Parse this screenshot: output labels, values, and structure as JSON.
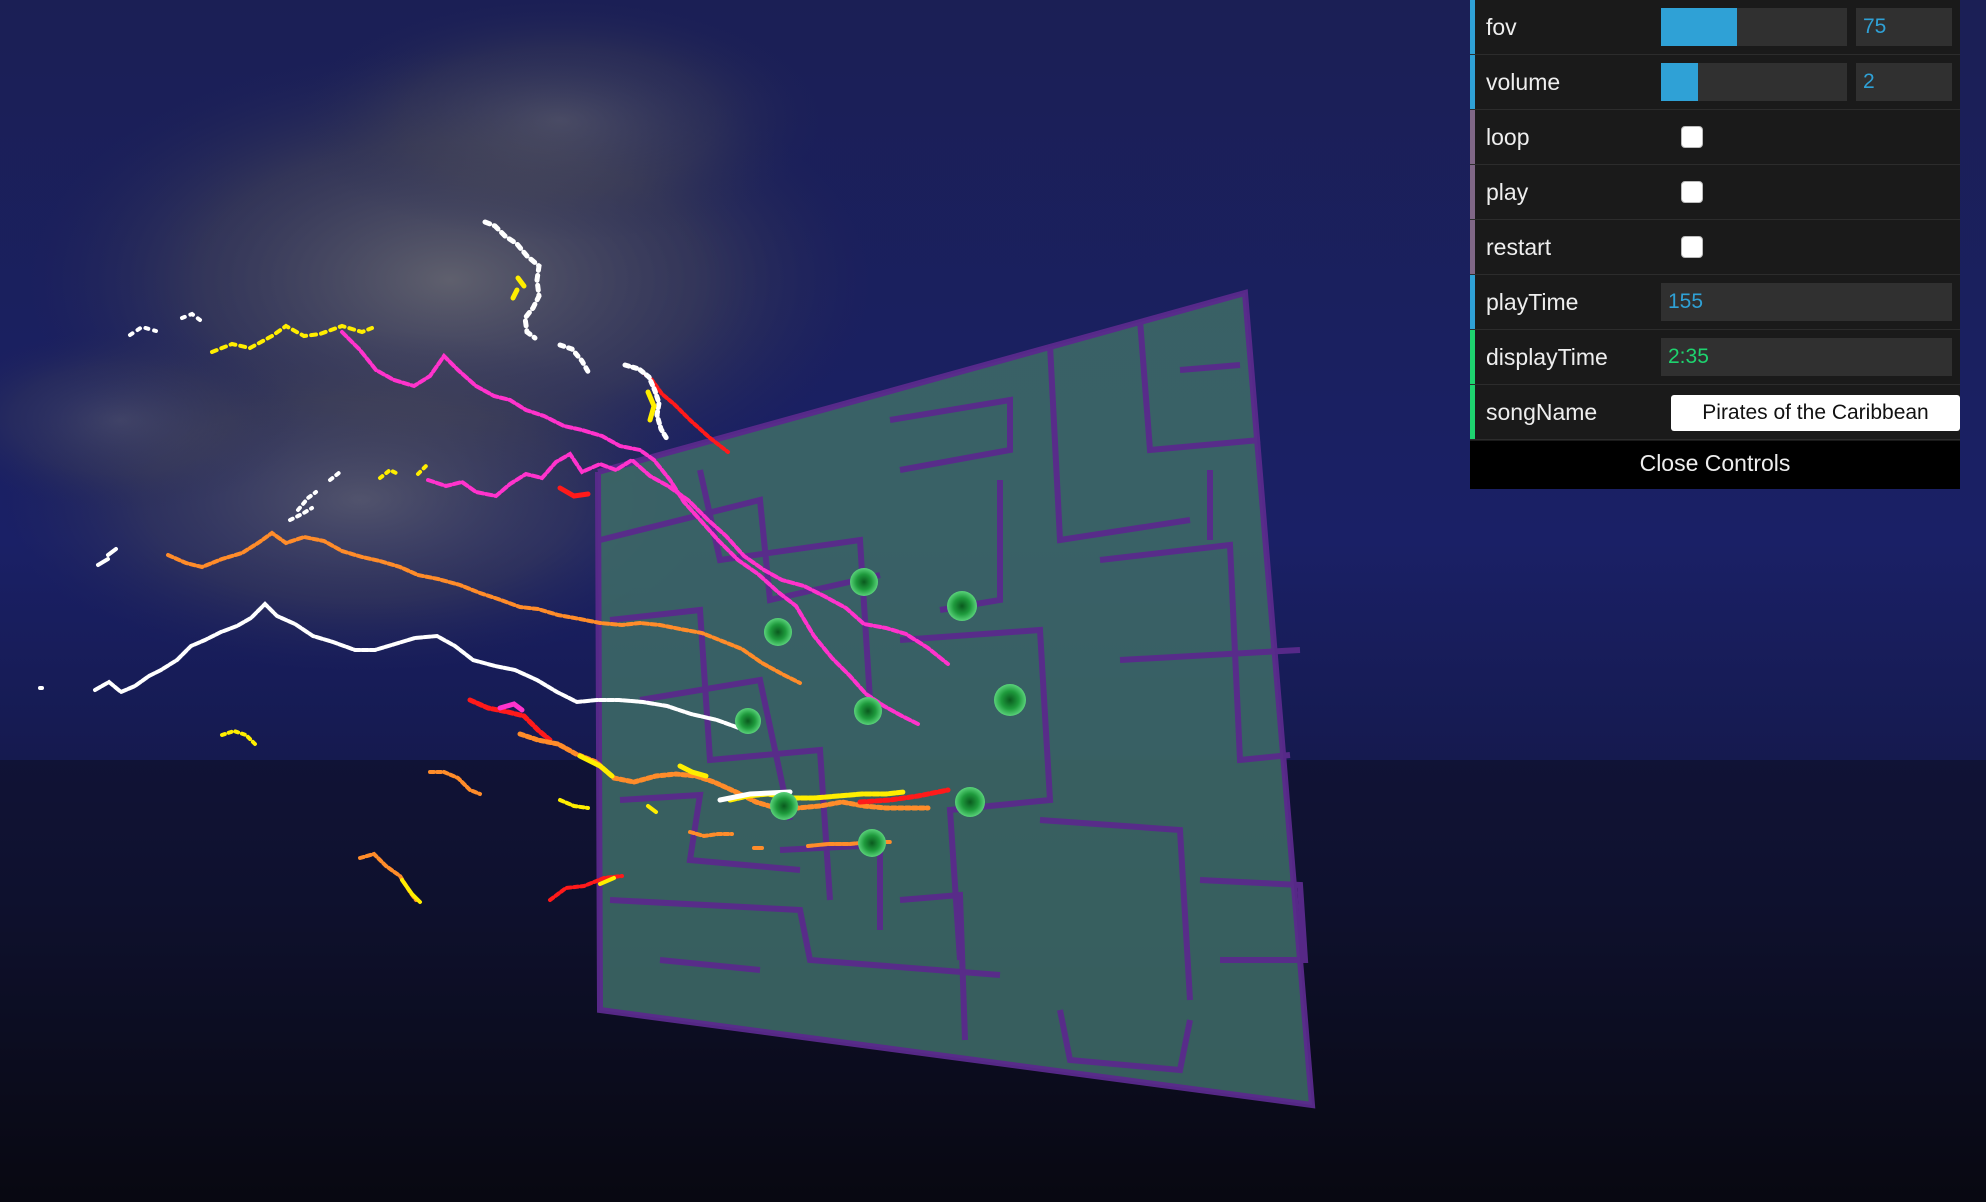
{
  "colors": {
    "number_accent": "#2fa1d6",
    "boolean_accent": "#806787",
    "string_accent": "#1ed36f",
    "trail_colors": [
      "#ff33cc",
      "#ff8c2a",
      "#ffffff",
      "#ffee00",
      "#ff1a1a"
    ],
    "node_color": "#1fa040",
    "maze_panel": "#3e6a66",
    "maze_walls": "#5a2a8c"
  },
  "controls": {
    "fov": {
      "label": "fov",
      "value": "75",
      "fraction": 0.41
    },
    "volume": {
      "label": "volume",
      "value": "2",
      "fraction": 0.2
    },
    "loop": {
      "label": "loop",
      "checked": false
    },
    "play": {
      "label": "play",
      "checked": false
    },
    "restart": {
      "label": "restart",
      "checked": false
    },
    "playTime": {
      "label": "playTime",
      "value": "155"
    },
    "displayTime": {
      "label": "displayTime",
      "value": "2:35"
    },
    "songName": {
      "label": "songName",
      "value": "Pirates of the Caribbean"
    },
    "close_label": "Close Controls"
  }
}
